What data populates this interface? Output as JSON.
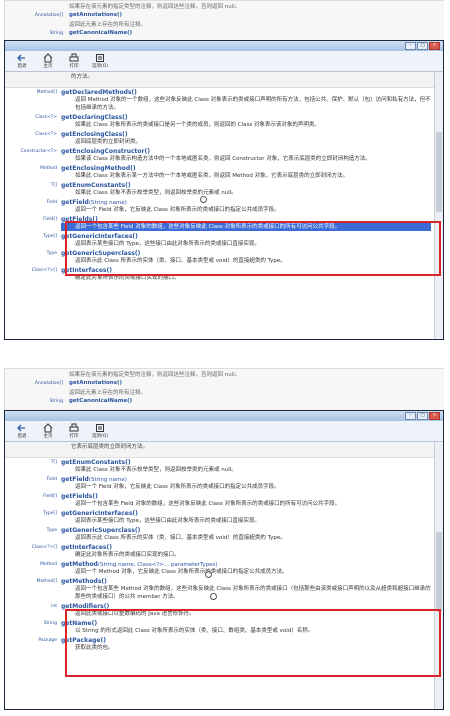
{
  "ghost_top": [
    {
      "kind": "",
      "text": "如果存在该元素的指定类型的注释，则返回这些注释，否则返回 null。",
      "link": false
    },
    {
      "kind": "Annotation[]",
      "text": "getAnnotations()",
      "link": true
    },
    {
      "kind": "",
      "text": "返回此元素上存在的所有注释。",
      "link": false
    },
    {
      "kind": "String",
      "text": "getCanonicalName()",
      "link": true
    }
  ],
  "toolbar": {
    "home": "主页",
    "back": "后退",
    "print": "打印",
    "options": "选项(O)"
  },
  "window_buttons": {
    "min": "–",
    "max": "□",
    "close": "✕"
  },
  "panel1": {
    "prev_text": "的方法。",
    "entries": [
      {
        "kind": "Method[]",
        "name": "getDeclaredMethods()",
        "sig": "",
        "desc": "返回 Method 对象的一个数组，这些对象反映此 Class 对象表示的类或接口声明的所有方法，包括公共、保护、默认（包）访问和私有方法，但不包括继承的方法。"
      },
      {
        "kind": "Class<?>",
        "name": "getDeclaringClass()",
        "sig": "",
        "desc": "如果此 Class 对象所表示的类或接口是另一个类的成员，则返回的 Class 对象表示该对象的声明类。"
      },
      {
        "kind": "Class<?>",
        "name": "getEnclosingClass()",
        "sig": "",
        "desc": "返回底层类的立即封闭类。"
      },
      {
        "kind": "Constructor<?>",
        "name": "getEnclosingConstructor()",
        "sig": "",
        "desc": "如果该 Class 对象表示构造方法中的一个本地或匿名类，则返回 Constructor 对象，它表示底层类的立即封闭构造方法。"
      },
      {
        "kind": "Method",
        "name": "getEnclosingMethod()",
        "sig": "",
        "desc": "如果此 Class 对象表示某一方法中的一个本地或匿名类，则返回 Method 对象，它表示底层类的立即封闭方法。"
      },
      {
        "kind": "T[]",
        "name": "getEnumConstants()",
        "sig": "",
        "desc": "如果此 Class 对象不表示枚举类型，则返回枚举类的元素或 null。"
      },
      {
        "kind": "Field",
        "name": "getField",
        "sig": "(String name)",
        "desc": "返回一个 Field 对象，它反映此 Class 对象所表示的类或接口的指定公共成员字段。"
      },
      {
        "kind": "Field[]",
        "name": "getFields()",
        "sig": "",
        "desc": "返回一个包含某些 Field 对象的数组，这些对象反映此 Class 对象所表示的类或接口的所有可访问公共字段。"
      },
      {
        "kind": "Type[]",
        "name": "getGenericInterfaces()",
        "sig": "",
        "desc": "返回表示某些接口的 Type，这些接口由此对象所表示的类或接口直接实现。"
      },
      {
        "kind": "Type",
        "name": "getGenericSuperclass()",
        "sig": "",
        "desc": "返回表示此 Class 所表示的实体（类、接口、基本类型或 void）的直接超类的 Type。"
      },
      {
        "kind": "Class<?>[]",
        "name": "getInterfaces()",
        "sig": "",
        "desc": "确定此对象所表示的类或接口实现的接口。"
      }
    ]
  },
  "panel2": {
    "prev_text": "它表示底层类的立即封闭方法。",
    "entries": [
      {
        "kind": "T[]",
        "name": "getEnumConstants()",
        "sig": "",
        "desc": "如果此 Class 对象不表示枚举类型，则返回枚举类的元素或 null。"
      },
      {
        "kind": "Field",
        "name": "getField",
        "sig": "(String name)",
        "desc": "返回一个 Field 对象，它反映此 Class 对象所表示的类或接口的指定公共成员字段。"
      },
      {
        "kind": "Field[]",
        "name": "getFields()",
        "sig": "",
        "desc": "返回一个包含某些 Field 对象的数组，这些对象反映此 Class 对象所表示的类或接口的所有可访问公共字段。"
      },
      {
        "kind": "Type[]",
        "name": "getGenericInterfaces()",
        "sig": "",
        "desc": "返回表示某些接口的 Type，这些接口由此对象所表示的类或接口直接实现。"
      },
      {
        "kind": "Type",
        "name": "getGenericSuperclass()",
        "sig": "",
        "desc": "返回表示此 Class 所表示的实体（类、接口、基本类型或 void）的直接超类的 Type。"
      },
      {
        "kind": "Class<?>[]",
        "name": "getInterfaces()",
        "sig": "",
        "desc": "确定此对象所表示的类或接口实现的接口。"
      },
      {
        "kind": "Method",
        "name": "getMethod",
        "sig": "(String name, Class<?>... parameterTypes)",
        "desc": "返回一个 Method 对象，它反映此 Class 对象所表示的类或接口的指定公共成员方法。"
      },
      {
        "kind": "Method[]",
        "name": "getMethods()",
        "sig": "",
        "desc": "返回一个包含某些 Method 对象的数组，这些对象反映此 Class 对象所表示的类或接口（包括那些由该类或接口声明的以及从超类和超接口继承的那些的类或接口）的公共 member 方法。"
      },
      {
        "kind": "int",
        "name": "getModifiers()",
        "sig": "",
        "desc": "返回此类或接口以整数编码的 Java 语言修饰符。"
      },
      {
        "kind": "String",
        "name": "getName()",
        "sig": "",
        "desc": "以 String 的形式返回此 Class 对象所表示的实体（类、接口、数组类、基本类型或 void）名称。"
      },
      {
        "kind": "Package",
        "name": "getPackage()",
        "sig": "",
        "desc": "获取此类的包。"
      }
    ]
  }
}
